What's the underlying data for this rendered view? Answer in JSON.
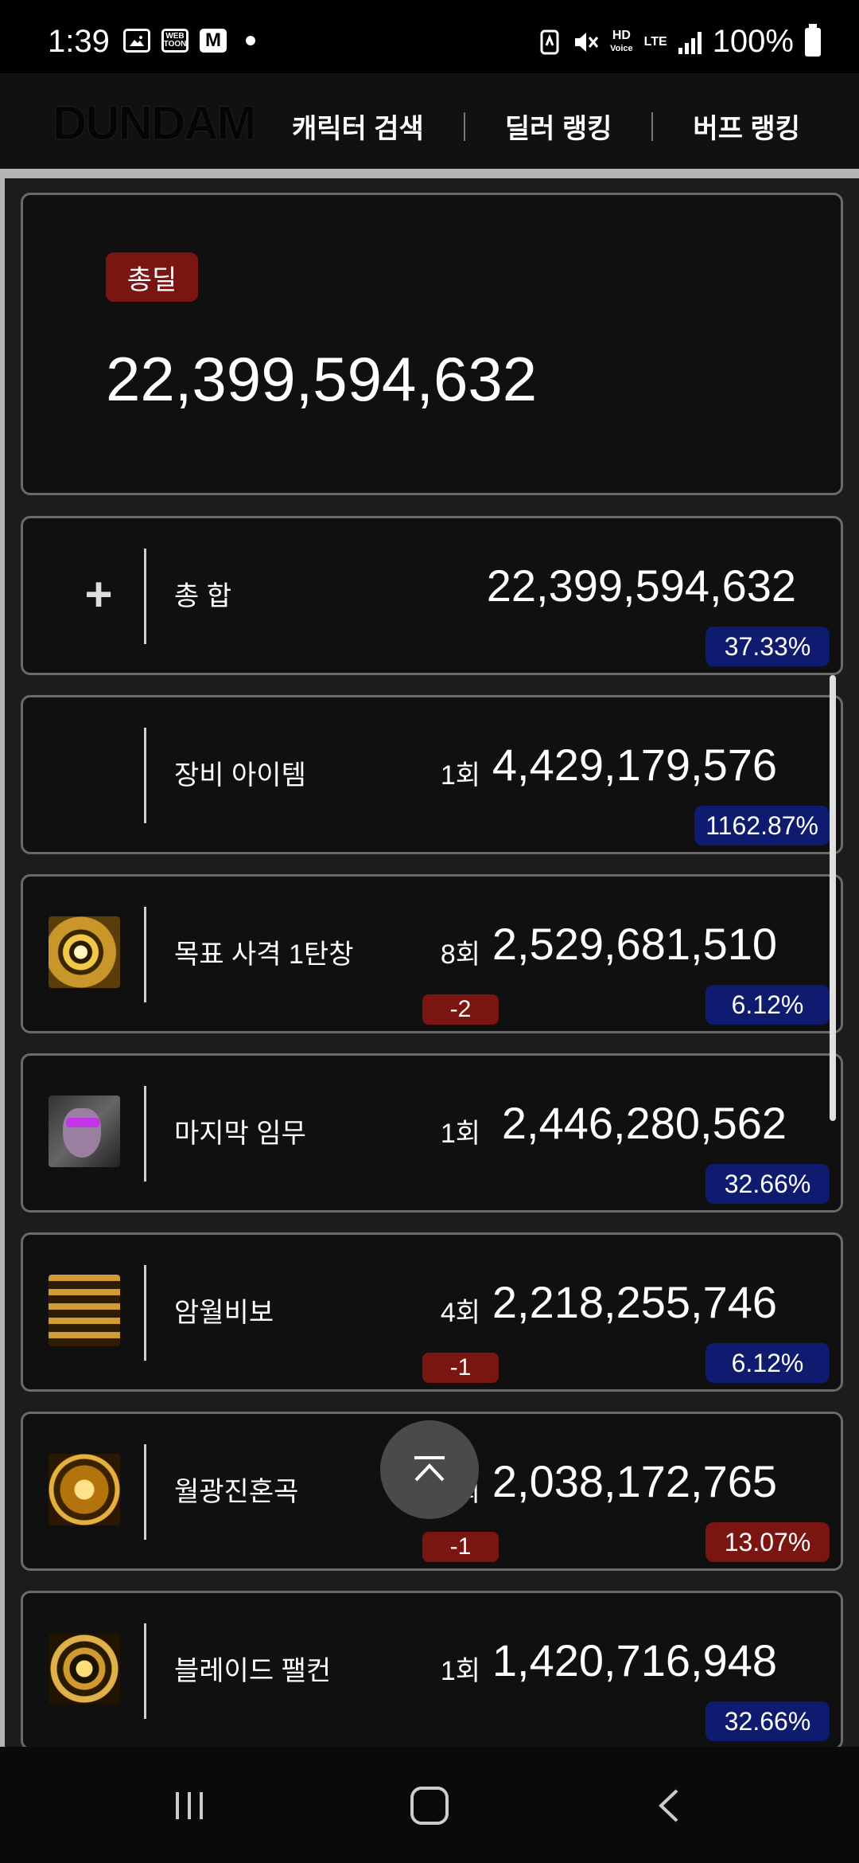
{
  "status_bar": {
    "time": "1:39",
    "icons": [
      "gallery-icon",
      "webtoon-icon",
      "gmail-icon",
      "notification-dot"
    ],
    "webtoon_label": "WEB TOON",
    "mail_label": "M",
    "hd_label": "HD",
    "voice_label": "Voice",
    "lte_label": "LTE",
    "battery": "100%"
  },
  "header": {
    "logo": "DUNDAM",
    "nav": [
      "캐릭터 검색",
      "딜러 랭킹",
      "버프 랭킹"
    ]
  },
  "total": {
    "badge": "총딜",
    "value": "22,399,594,632"
  },
  "rows": [
    {
      "icon": "plus-icon",
      "name": "총 합",
      "count": "",
      "diff": "",
      "value": "22,399,594,632",
      "percent": "37.33%",
      "percent_color": "blue"
    },
    {
      "icon": "",
      "name": "장비 아이템",
      "count": "1회",
      "diff": "",
      "value": "4,429,179,576",
      "percent": "1162.87%",
      "percent_color": "blue"
    },
    {
      "icon": "target-shot-icon",
      "name": "목표 사격 1탄창",
      "count": "8회",
      "diff": "-2",
      "value": "2,529,681,510",
      "percent": "6.12%",
      "percent_color": "blue"
    },
    {
      "icon": "last-mission-icon",
      "name": "마지막 임무",
      "count": "1회",
      "diff": "",
      "value": "2,446,280,562",
      "percent": "32.66%",
      "percent_color": "blue"
    },
    {
      "icon": "secret-art-icon",
      "name": "암월비보",
      "count": "4회",
      "diff": "-1",
      "value": "2,218,255,746",
      "percent": "6.12%",
      "percent_color": "blue"
    },
    {
      "icon": "moonlight-requiem-icon",
      "name": "월광진혼곡",
      "count": "2회",
      "diff": "-1",
      "value": "2,038,172,765",
      "percent": "13.07%",
      "percent_color": "red"
    },
    {
      "icon": "blade-falcon-icon",
      "name": "블레이드 팰컨",
      "count": "1회",
      "diff": "",
      "value": "1,420,716,948",
      "percent": "32.66%",
      "percent_color": "blue"
    }
  ],
  "colors": {
    "badge_red": "#7a1511",
    "badge_blue": "#0e1b6e",
    "card_bg": "#101010"
  }
}
